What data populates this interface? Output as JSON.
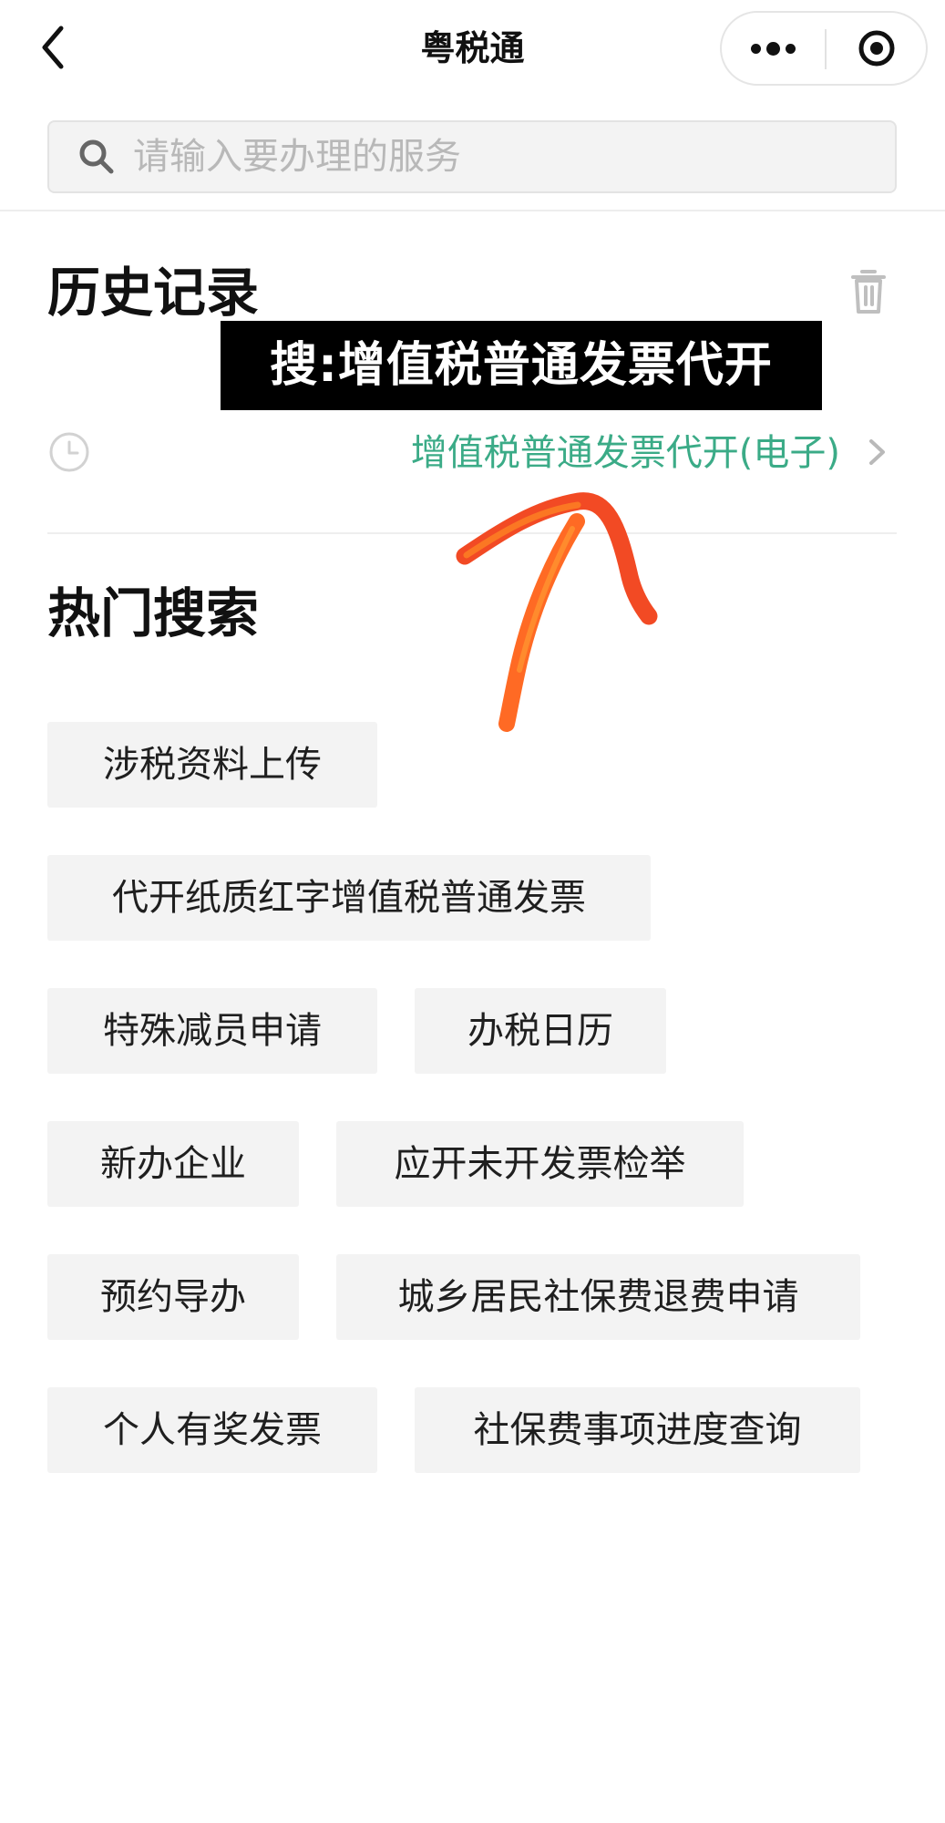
{
  "app": {
    "title": "粤税通"
  },
  "search": {
    "placeholder": "请输入要办理的服务",
    "value": ""
  },
  "history": {
    "title": "历史记录",
    "items": [
      {
        "label": "增值税普通发票代开(电子)"
      }
    ]
  },
  "overlay": {
    "text": "搜:增值税普通发票代开"
  },
  "hot": {
    "title": "热门搜索",
    "items": [
      {
        "label": "涉税资料上传"
      },
      {
        "label": "代开纸质红字增值税普通发票"
      },
      {
        "label": "特殊减员申请"
      },
      {
        "label": "办税日历"
      },
      {
        "label": "新办企业"
      },
      {
        "label": "应开未开发票检举"
      },
      {
        "label": "预约导办"
      },
      {
        "label": "城乡居民社保费退费申请"
      },
      {
        "label": "个人有奖发票"
      },
      {
        "label": "社保费事项进度查询"
      }
    ]
  },
  "colors": {
    "accent": "#3bab87",
    "chip_background": "#f3f3f3",
    "doodle": "#f24a24"
  },
  "icons": {
    "back": "chevron-left-icon",
    "more": "more-dots-icon",
    "close": "target-close-icon",
    "search": "search-icon",
    "trash": "trash-icon",
    "history_clock": "clock-icon",
    "history_arrow": "chevron-right-icon",
    "annotation": "hand-drawn-arrow"
  }
}
